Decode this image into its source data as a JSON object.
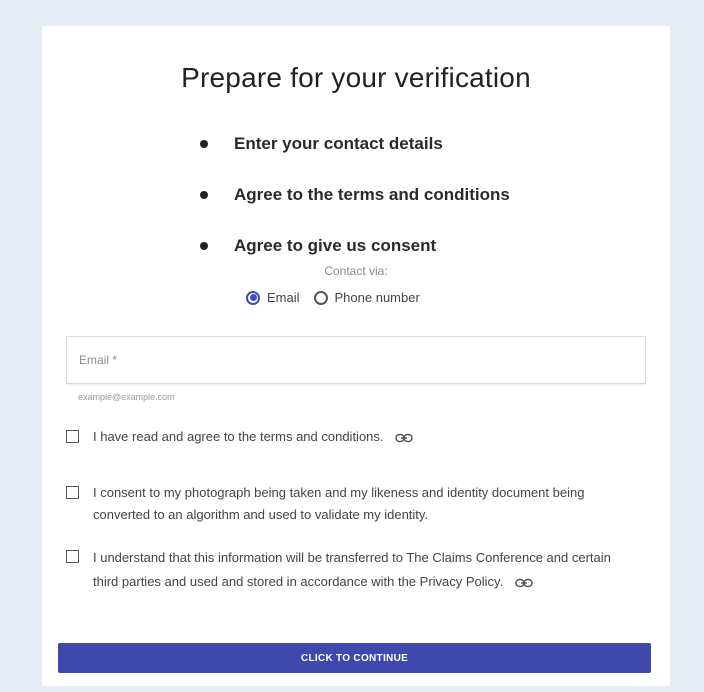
{
  "title": "Prepare for your verification",
  "steps": [
    "Enter your contact details",
    "Agree to the terms and conditions",
    "Agree to give us consent"
  ],
  "contact": {
    "label": "Contact via:",
    "options": [
      {
        "label": "Email",
        "selected": true
      },
      {
        "label": "Phone number",
        "selected": false
      }
    ]
  },
  "email_field": {
    "placeholder": "Email *",
    "helper": "example@example.com"
  },
  "checkboxes": [
    {
      "text": "I have read and agree to the terms and conditions.",
      "link_icon": "link-icon",
      "checked": false
    },
    {
      "text": "I consent to my photograph being taken and my likeness and identity document being converted to an algorithm and used to validate my identity.",
      "checked": false
    },
    {
      "text": "I understand that this information will be transferred to The Claims Conference and certain third parties and used and stored in accordance with the Privacy Policy.",
      "link_icon": "link-icon",
      "checked": false
    }
  ],
  "continue_label": "CLICK TO CONTINUE",
  "colors": {
    "accent": "#3f48ad",
    "page_background": "#e4ebf2"
  }
}
